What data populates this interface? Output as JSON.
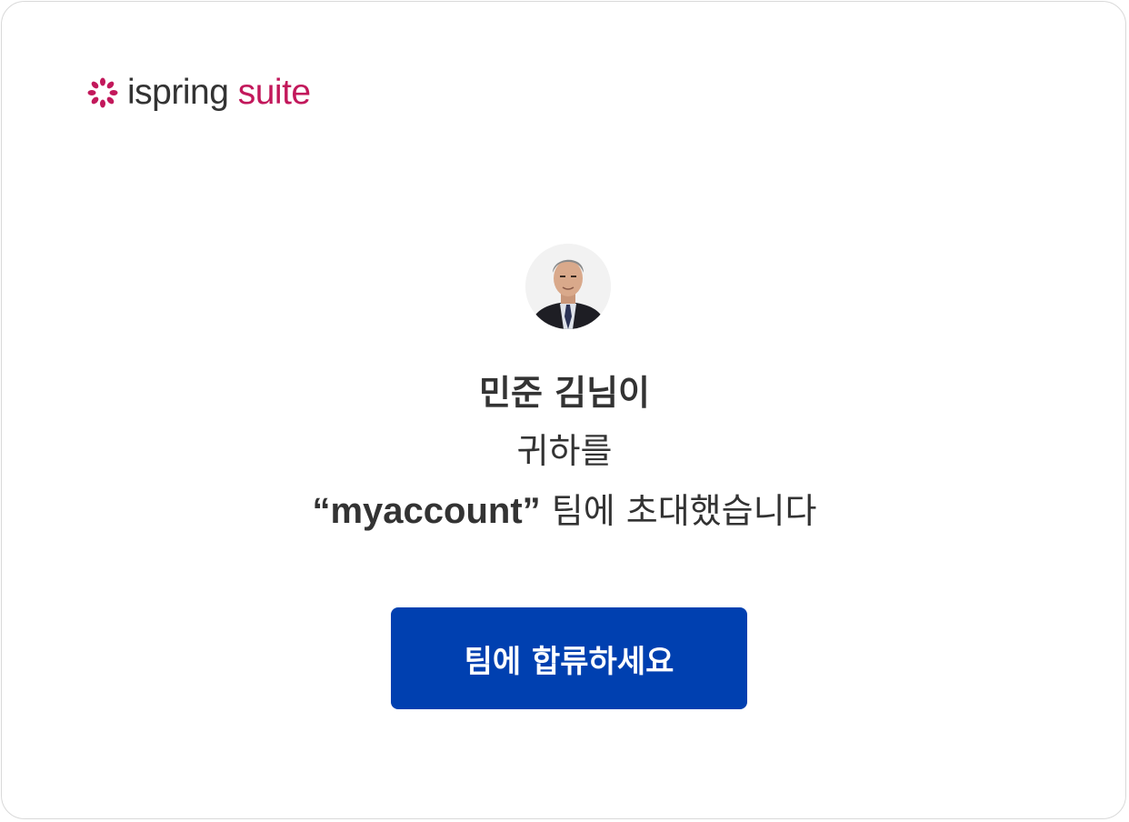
{
  "brand": {
    "name_part1": "ispring",
    "name_part2": "suite",
    "logo_icon": "ispring-star-icon",
    "brand_color": "#c2185b",
    "text_color": "#333333"
  },
  "invite": {
    "avatar_icon": "user-avatar-photo",
    "inviter_name": "민준 김님이",
    "line1": "귀하를",
    "team_name": "“myaccount”",
    "line2_suffix": "팀에 초대했습니다"
  },
  "actions": {
    "join_label": "팀에 합류하세요",
    "button_color": "#0040b0"
  }
}
